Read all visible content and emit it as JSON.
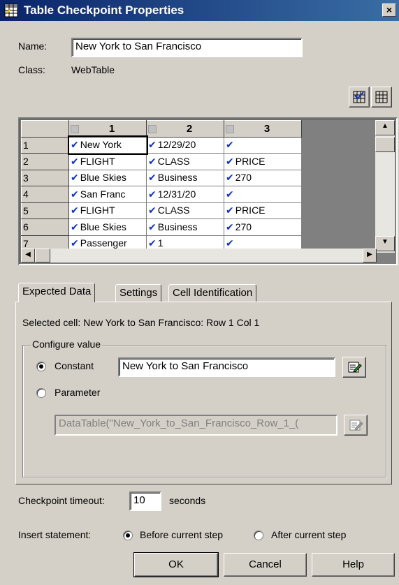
{
  "window": {
    "title": "Table Checkpoint Properties",
    "close": "×"
  },
  "fields": {
    "name_label": "Name:",
    "name_value": "New York to San Francisco",
    "class_label": "Class:",
    "class_value": "WebTable"
  },
  "grid": {
    "columns": [
      "1",
      "2",
      "3"
    ],
    "rows": [
      {
        "num": "1",
        "cells": [
          "New York",
          "12/29/20",
          ""
        ]
      },
      {
        "num": "2",
        "cells": [
          "FLIGHT",
          "CLASS",
          "PRICE"
        ]
      },
      {
        "num": "3",
        "cells": [
          "Blue Skies",
          "Business",
          "270"
        ]
      },
      {
        "num": "4",
        "cells": [
          "San Franc",
          "12/31/20",
          ""
        ]
      },
      {
        "num": "5",
        "cells": [
          "FLIGHT",
          "CLASS",
          "PRICE"
        ]
      },
      {
        "num": "6",
        "cells": [
          "Blue Skies",
          "Business",
          "270"
        ]
      },
      {
        "num": "7",
        "cells": [
          "Passenger",
          "1",
          ""
        ]
      }
    ],
    "check_glyph": "✔"
  },
  "tabs": [
    "Expected Data",
    "Settings",
    "Cell Identification"
  ],
  "expected": {
    "selected_cell": "Selected cell: New York to San Francisco: Row 1 Col 1",
    "group_label": "Configure value",
    "constant_label": "Constant",
    "constant_value": "New York to San Francisco",
    "parameter_label": "Parameter",
    "parameter_value": "DataTable(\"New_York_to_San_Francisco_Row_1_("
  },
  "timeout": {
    "label": "Checkpoint timeout:",
    "value": "10",
    "unit": "seconds"
  },
  "insert": {
    "label": "Insert statement:",
    "before": "Before current step",
    "after": "After current step"
  },
  "buttons": {
    "ok": "OK",
    "cancel": "Cancel",
    "help": "Help"
  }
}
